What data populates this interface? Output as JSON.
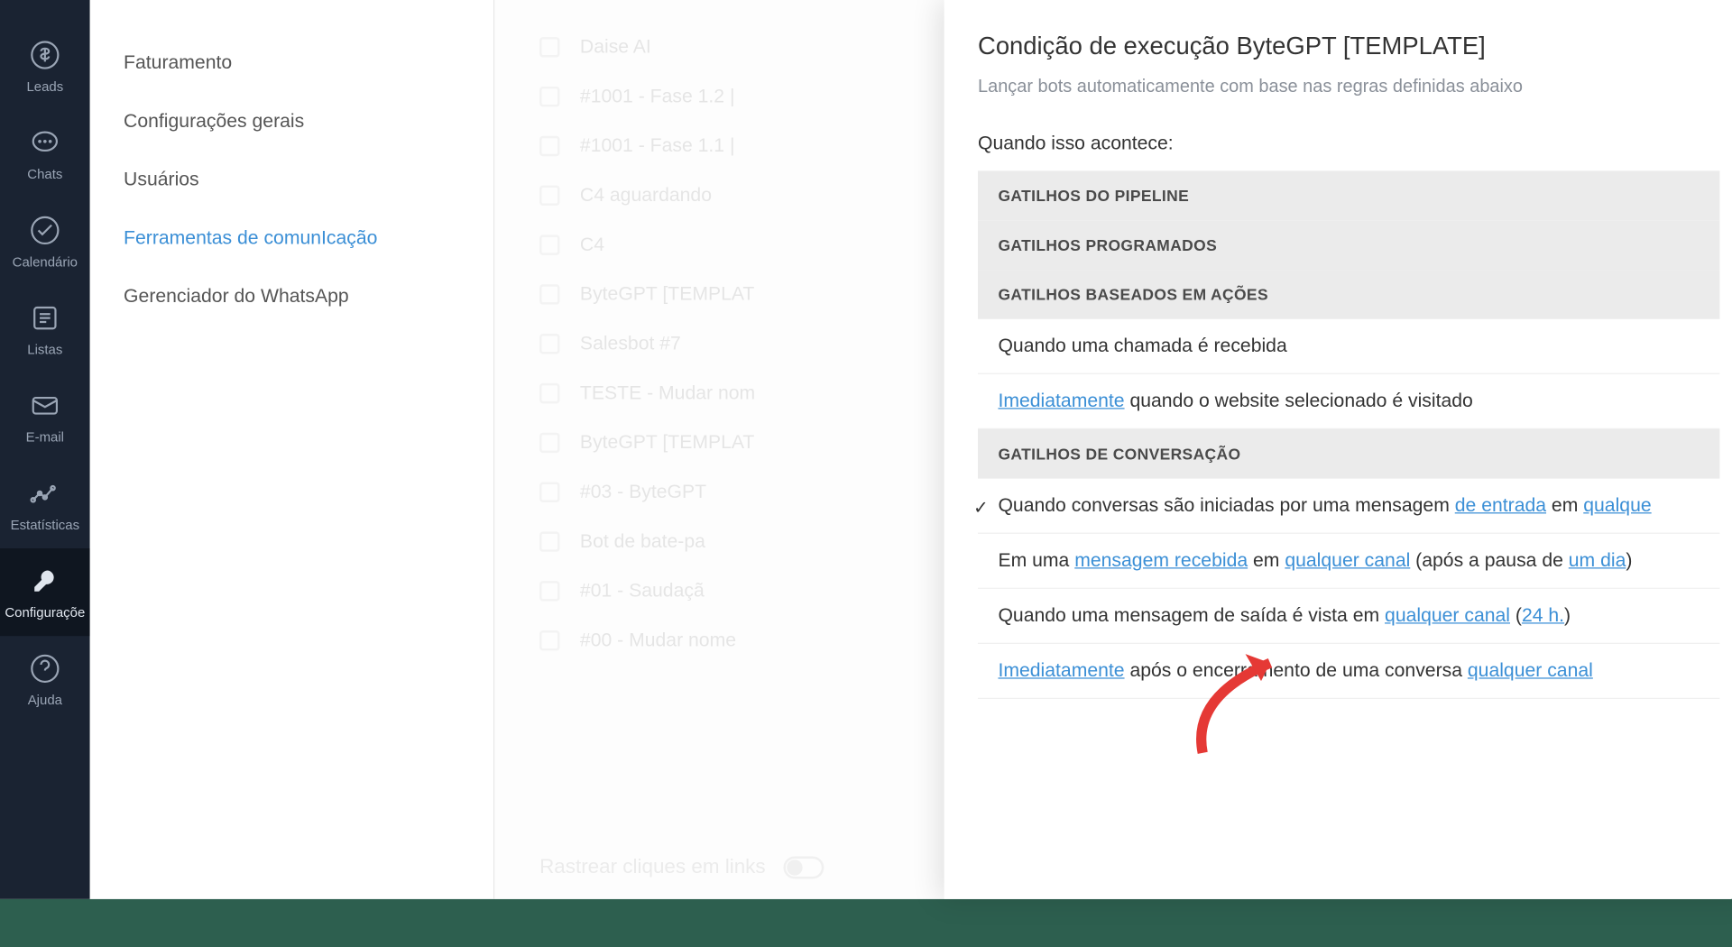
{
  "rail": [
    {
      "icon": "dollar",
      "label": "Leads"
    },
    {
      "icon": "chat",
      "label": "Chats"
    },
    {
      "icon": "check",
      "label": "Calendário"
    },
    {
      "icon": "list",
      "label": "Listas"
    },
    {
      "icon": "mail",
      "label": "E-mail"
    },
    {
      "icon": "stats",
      "label": "Estatísticas"
    },
    {
      "icon": "wrench",
      "label": "Configuraçõe"
    },
    {
      "icon": "help",
      "label": "Ajuda"
    }
  ],
  "rail_active_index": 6,
  "settings_menu": [
    "Faturamento",
    "Configurações gerais",
    "Usuários",
    "Ferramentas de comunIcação",
    "Gerenciador do WhatsApp"
  ],
  "settings_active_index": 3,
  "bg_items": [
    "Daise AI",
    "#1001 - Fase 1.2 | ",
    "#1001 - Fase 1.1 | ",
    "C4 aguardando",
    "C4",
    "ByteGPT [TEMPLAT",
    "Salesbot #7",
    "TESTE - Mudar nom",
    "ByteGPT [TEMPLAT",
    "#03 - ByteGPT",
    "Bot de bate-pa",
    "#01 - Saudaçã",
    "#00 - Mudar nome"
  ],
  "bg_footer": "Rastrear cliques em links",
  "panel": {
    "title": "Condição de execução ByteGPT [TEMPLATE]",
    "subtitle": "Lançar bots automaticamente com base nas regras definidas abaixo",
    "when_label": "Quando isso acontece:",
    "sections": {
      "pipeline": "GATILHOS DO PIPELINE",
      "scheduled": "GATILHOS PROGRAMADOS",
      "action": "GATILHOS BASEADOS EM AÇÕES",
      "conversation": "GATILHOS DE CONVERSAÇÃO"
    },
    "action_triggers": {
      "call_received": "Quando uma chamada é recebida",
      "website_pre": "Imediatamente",
      "website_post": " quando o website selecionado é visitado"
    },
    "conv": {
      "t1_pre": "Quando conversas são iniciadas por uma mensagem ",
      "t1_link1": "de entrada",
      "t1_mid": " em  ",
      "t1_link2": "qualque",
      "t2_pre": "Em uma ",
      "t2_link1": "mensagem recebida",
      "t2_mid1": " em  ",
      "t2_link2": "qualquer canal",
      "t2_mid2": " (após a pausa de ",
      "t2_link3": "um dia",
      "t2_post": ")",
      "t3_pre": "Quando uma mensagem de saída é vista em  ",
      "t3_link1": "qualquer canal",
      "t3_mid": "  (",
      "t3_link2": "24 h.",
      "t3_post": ")",
      "t4_link1": "Imediatamente",
      "t4_mid": " após o encerramento de uma conversa  ",
      "t4_link2": "qualquer canal"
    }
  }
}
